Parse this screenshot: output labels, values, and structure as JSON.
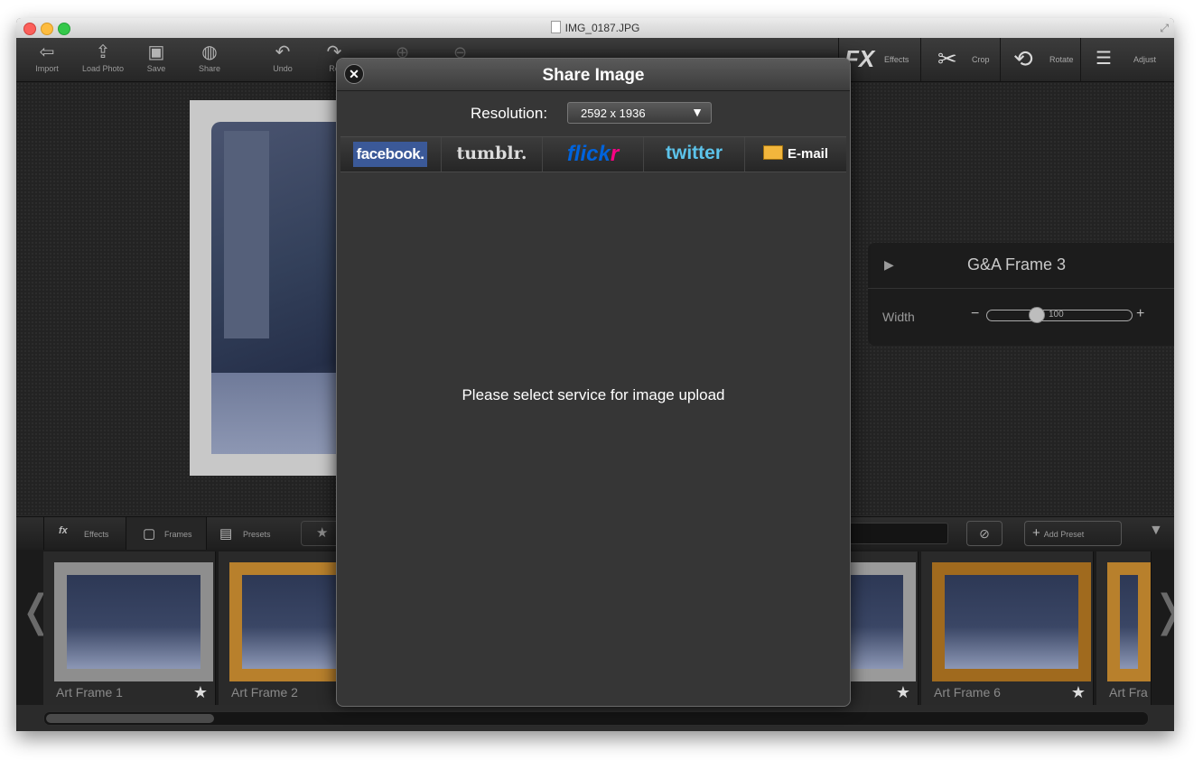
{
  "window": {
    "title": "IMG_0187.JPG"
  },
  "toolbar": {
    "import": "Import",
    "load_photo": "Load Photo",
    "save": "Save",
    "share": "Share",
    "undo": "Undo",
    "redo": "Re",
    "tabs": {
      "effects": "Effects",
      "crop": "Crop",
      "rotate": "Rotate",
      "adjust": "Adjust"
    }
  },
  "panel": {
    "title": "G&A Frame 3",
    "width_label": "Width",
    "width_value": "100"
  },
  "bottom_tabs": {
    "effects": "Effects",
    "frames": "Frames",
    "presets": "Presets",
    "add_preset": "Add Preset"
  },
  "frames": [
    {
      "label": "Art Frame 1",
      "color": "#8e8e8e"
    },
    {
      "label": "Art Frame 2",
      "color": "#b8802c"
    },
    {
      "label": "",
      "color": "#9a9a9a"
    },
    {
      "label": "Art Frame 6",
      "color": "#a06a1e"
    },
    {
      "label": "Art Fra",
      "color": "#b8802c"
    }
  ],
  "dialog": {
    "title": "Share Image",
    "resolution_label": "Resolution:",
    "resolution_value": "2592 x 1936",
    "services": {
      "facebook": "facebook.",
      "tumblr": "tumblr.",
      "flickr_a": "flick",
      "flickr_b": "r",
      "twitter": "twitter",
      "email": "E-mail"
    },
    "message": "Please select service for image upload"
  },
  "colors": {
    "facebook": "#3b5998",
    "flickr_blue": "#0063dc",
    "flickr_pink": "#ff0084",
    "twitter": "#5cc3ea"
  }
}
